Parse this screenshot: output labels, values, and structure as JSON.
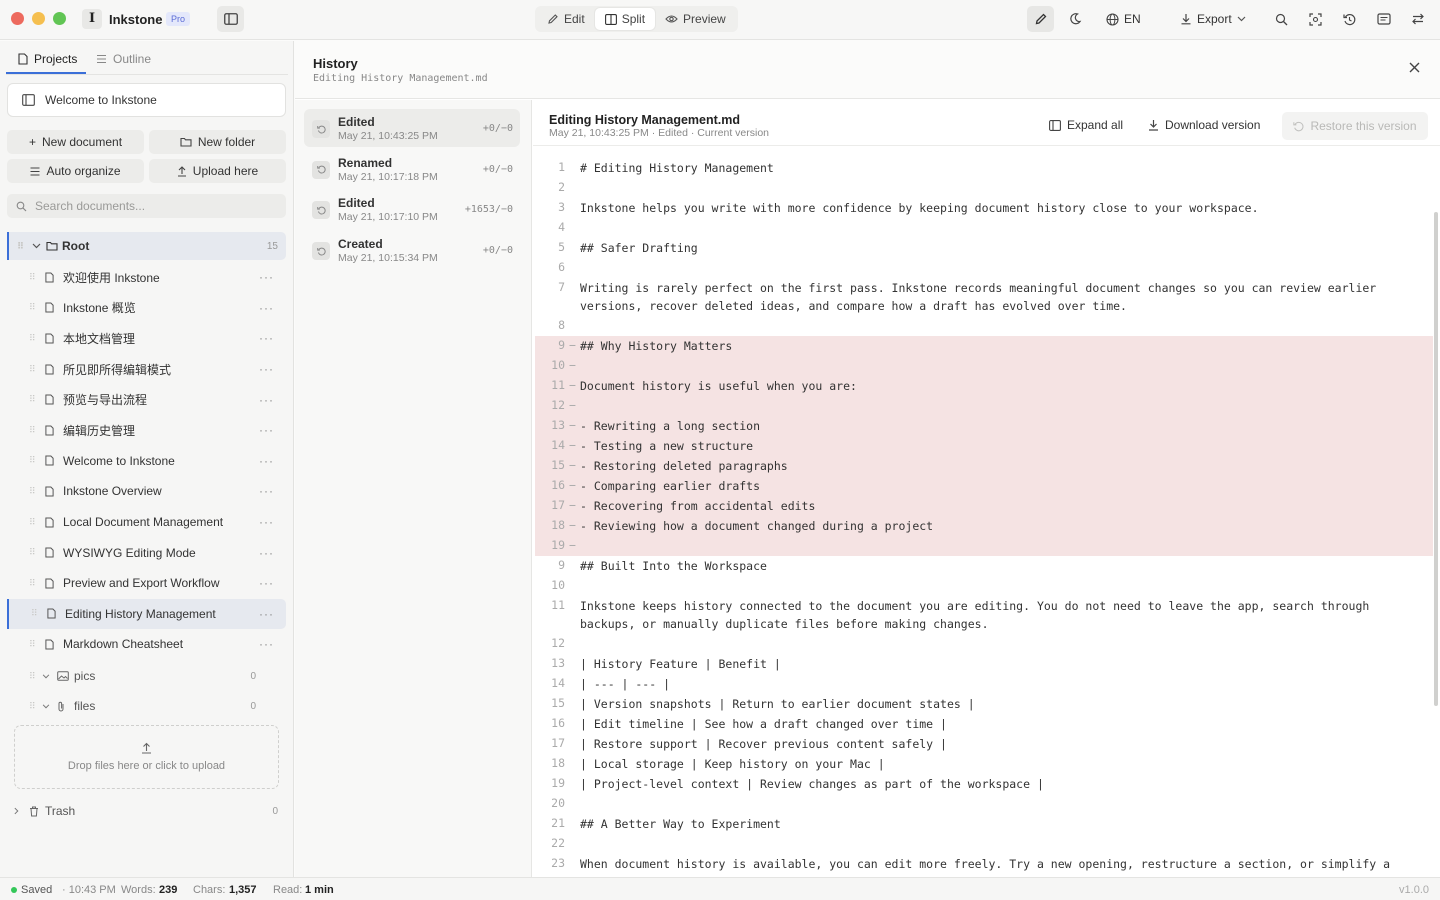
{
  "app": {
    "name": "Inkstone",
    "badge": "Pro",
    "logo_letter": "I"
  },
  "toolbar": {
    "modes": [
      "Edit",
      "Split",
      "Preview"
    ],
    "active_mode": "Split",
    "language": "EN",
    "export_label": "Export"
  },
  "sidebar": {
    "tabs": {
      "projects": "Projects",
      "outline": "Outline"
    },
    "welcome": "Welcome to Inkstone",
    "buttons": {
      "new_document": "New document",
      "new_folder": "New folder",
      "auto_organize": "Auto organize",
      "upload_here": "Upload here"
    },
    "search_placeholder": "Search documents...",
    "root": {
      "label": "Root",
      "count": "15"
    },
    "items": [
      {
        "label": "欢迎使用 Inkstone"
      },
      {
        "label": "Inkstone 概览"
      },
      {
        "label": "本地文档管理"
      },
      {
        "label": "所见即所得编辑模式"
      },
      {
        "label": "预览与导出流程"
      },
      {
        "label": "编辑历史管理"
      },
      {
        "label": "Welcome to Inkstone"
      },
      {
        "label": "Inkstone Overview"
      },
      {
        "label": "Local Document Management"
      },
      {
        "label": "WYSIWYG Editing Mode"
      },
      {
        "label": "Preview and Export Workflow"
      },
      {
        "label": "Editing History Management",
        "active": true
      },
      {
        "label": "Markdown Cheatsheet"
      }
    ],
    "more_glyph": "···",
    "folders": [
      {
        "label": "pics",
        "count": "0"
      },
      {
        "label": "files",
        "count": "0"
      }
    ],
    "dropzone": "Drop files here or click to upload",
    "trash": {
      "label": "Trash",
      "count": "0"
    }
  },
  "history": {
    "title": "History",
    "file": "Editing History Management.md",
    "versions": [
      {
        "title": "Edited",
        "time": "May 21, 10:43:25 PM",
        "diff": "+0/−0",
        "active": true
      },
      {
        "title": "Renamed",
        "time": "May 21, 10:17:18 PM",
        "diff": "+0/−0"
      },
      {
        "title": "Edited",
        "time": "May 21, 10:17:10 PM",
        "diff": "+1653/−0"
      },
      {
        "title": "Created",
        "time": "May 21, 10:15:34 PM",
        "diff": "+0/−0"
      }
    ],
    "diff": {
      "title": "Editing History Management.md",
      "subtitle": "May 21, 10:43:25 PM · Edited · Current version",
      "expand_all": "Expand all",
      "download": "Download version",
      "restore": "Restore this version"
    },
    "lines": [
      {
        "n": "1",
        "m": "",
        "t": "# Editing History Management"
      },
      {
        "n": "2",
        "m": "",
        "t": ""
      },
      {
        "n": "3",
        "m": "",
        "t": "Inkstone helps you write with more confidence by keeping document history close to your workspace."
      },
      {
        "n": "4",
        "m": "",
        "t": ""
      },
      {
        "n": "5",
        "m": "",
        "t": "## Safer Drafting"
      },
      {
        "n": "6",
        "m": "",
        "t": ""
      },
      {
        "n": "7",
        "m": "",
        "t": "Writing is rarely perfect on the first pass. Inkstone records meaningful document changes so you can review earlier versions, recover deleted ideas, and compare how a draft has evolved over time."
      },
      {
        "n": "8",
        "m": "",
        "t": ""
      },
      {
        "n": "9",
        "m": "−",
        "t": "## Why History Matters",
        "rm": true
      },
      {
        "n": "10",
        "m": "−",
        "t": "",
        "rm": true
      },
      {
        "n": "11",
        "m": "−",
        "t": "Document history is useful when you are:",
        "rm": true
      },
      {
        "n": "12",
        "m": "−",
        "t": "",
        "rm": true
      },
      {
        "n": "13",
        "m": "−",
        "t": "- Rewriting a long section",
        "rm": true
      },
      {
        "n": "14",
        "m": "−",
        "t": "- Testing a new structure",
        "rm": true
      },
      {
        "n": "15",
        "m": "−",
        "t": "- Restoring deleted paragraphs",
        "rm": true
      },
      {
        "n": "16",
        "m": "−",
        "t": "- Comparing earlier drafts",
        "rm": true
      },
      {
        "n": "17",
        "m": "−",
        "t": "- Recovering from accidental edits",
        "rm": true
      },
      {
        "n": "18",
        "m": "−",
        "t": "- Reviewing how a document changed during a project",
        "rm": true
      },
      {
        "n": "19",
        "m": "−",
        "t": "",
        "rm": true
      },
      {
        "n": "9",
        "m": "",
        "t": "## Built Into the Workspace"
      },
      {
        "n": "10",
        "m": "",
        "t": ""
      },
      {
        "n": "11",
        "m": "",
        "t": "Inkstone keeps history connected to the document you are editing. You do not need to leave the app, search through backups, or manually duplicate files before making changes."
      },
      {
        "n": "12",
        "m": "",
        "t": ""
      },
      {
        "n": "13",
        "m": "",
        "t": "| History Feature | Benefit |"
      },
      {
        "n": "14",
        "m": "",
        "t": "| --- | --- |"
      },
      {
        "n": "15",
        "m": "",
        "t": "| Version snapshots | Return to earlier document states |"
      },
      {
        "n": "16",
        "m": "",
        "t": "| Edit timeline | See how a draft changed over time |"
      },
      {
        "n": "17",
        "m": "",
        "t": "| Restore support | Recover previous content safely |"
      },
      {
        "n": "18",
        "m": "",
        "t": "| Local storage | Keep history on your Mac |"
      },
      {
        "n": "19",
        "m": "",
        "t": "| Project-level context | Review changes as part of the workspace |"
      },
      {
        "n": "20",
        "m": "",
        "t": ""
      },
      {
        "n": "21",
        "m": "",
        "t": "## A Better Way to Experiment"
      },
      {
        "n": "22",
        "m": "",
        "t": ""
      },
      {
        "n": "23",
        "m": "",
        "t": "When document history is available, you can edit more freely. Try a new opening, restructure a section, or simplify a draft without worrying that earlier work is gone forever."
      }
    ]
  },
  "status": {
    "saved": "Saved",
    "saved_time": "· 10:43 PM",
    "words_label": "Words:",
    "words": "239",
    "chars_label": "Chars:",
    "chars": "1,357",
    "read_label": "Read:",
    "read": "1 min",
    "version": "v1.0.0"
  },
  "colors": {
    "accent": "#3b6fd8",
    "removed_bg": "#f5e3e3",
    "saved_dot": "#34c759"
  }
}
